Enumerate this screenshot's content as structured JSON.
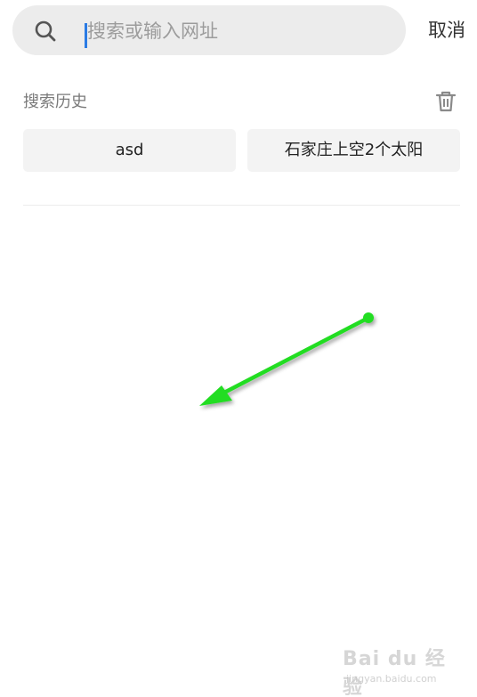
{
  "search": {
    "placeholder": "搜索或输入网址",
    "value": "",
    "cancel_label": "取消"
  },
  "history": {
    "title": "搜索历史",
    "items": [
      {
        "label": "asd"
      },
      {
        "label": "石家庄上空2个太阳"
      }
    ]
  },
  "icons": {
    "search": "search-icon",
    "trash": "trash-icon"
  },
  "colors": {
    "caret": "#2a7be4",
    "arrow": "#22dd22",
    "search_bg": "#ececec",
    "chip_bg": "#f3f3f3"
  },
  "watermark": {
    "brand": "Bai du 经验",
    "url": "jingyan.baidu.com"
  }
}
